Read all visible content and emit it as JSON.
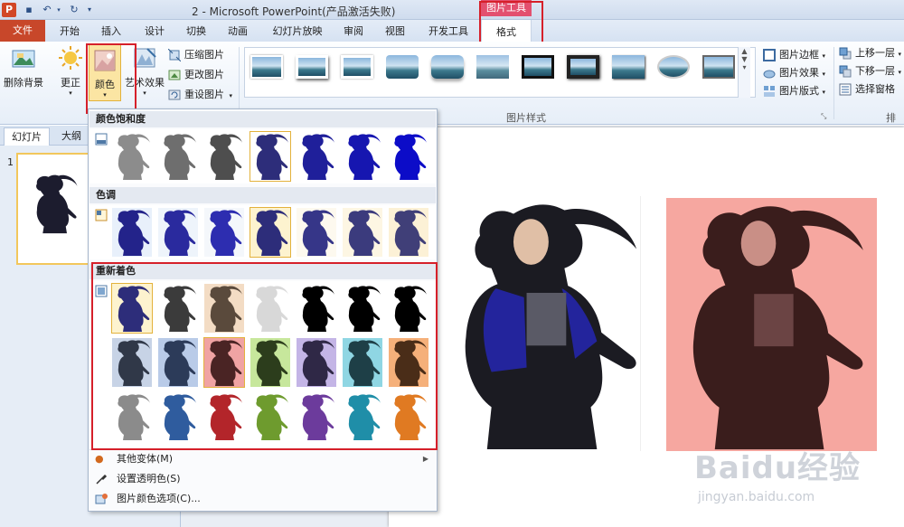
{
  "window": {
    "title": "2  -  Microsoft PowerPoint(产品激活失败)",
    "contextual_tools": "图片工具"
  },
  "tabs": [
    "文件",
    "开始",
    "插入",
    "设计",
    "切换",
    "动画",
    "幻灯片放映",
    "审阅",
    "视图",
    "开发工具",
    "格式"
  ],
  "ribbon": {
    "remove_background": "删除背景",
    "corrections": "更正",
    "color": "颜色",
    "artistic_effects": "艺术效果",
    "compress": "压缩图片",
    "change": "更改图片",
    "reset": "重设图片",
    "picture_border": "图片边框",
    "picture_effects": "图片效果",
    "picture_layout": "图片版式",
    "bring_forward": "上移一层",
    "send_backward": "下移一层",
    "selection_pane": "选择窗格",
    "group_styles": "图片样式",
    "group_arrange": "排列"
  },
  "left_pane": {
    "tab_slides": "幻灯片",
    "tab_outline": "大纲",
    "slide_number": "1"
  },
  "color_menu": {
    "saturation": "颜色饱和度",
    "tone": "色调",
    "recolor": "重新着色",
    "saturation_tints": [
      "#8c8c8c",
      "#6e6e6e",
      "#4e4e4e",
      "#2d2d7a",
      "#1f1f9a",
      "#1616b0",
      "#0c0cc8"
    ],
    "tone_tints": [
      "#23238a",
      "#2a2a9e",
      "#2d2db0",
      "#2d2d7a",
      "#363688",
      "#3b3b7d",
      "#403f78"
    ],
    "tone_backgrounds": [
      "#e8f0fb",
      "#eef4fb",
      "#f4f7fb",
      "#fdf3cf",
      "#fdf9ef",
      "#fdf6e3",
      "#fcf1d6"
    ],
    "recolor_row1_backgrounds": [
      "#fdf3cf",
      "#ffffff",
      "#f3dcc4",
      "#ffffff",
      "#ffffff",
      "#ffffff",
      "#ffffff"
    ],
    "recolor_row1_fills": [
      "#2d2d7a",
      "#3b3b3b",
      "#5a4a3c",
      "#d8d8d8",
      "#000000",
      "#000000",
      "#000000"
    ],
    "recolor_row2_backgrounds": [
      "#c7d3e6",
      "#b9cbe8",
      "#f0a3a3",
      "#c7e79c",
      "#c4b5e6",
      "#8fd6e3",
      "#f5b07a"
    ],
    "recolor_row2_fills": [
      "#303848",
      "#2c3b59",
      "#4a2424",
      "#2c3d1c",
      "#2f2846",
      "#1e3f47",
      "#4a2d18"
    ],
    "recolor_row3_fills": [
      "#8b8b8b",
      "#2f5c9e",
      "#b3252a",
      "#6e9b2e",
      "#6c3b9c",
      "#1f8ea8",
      "#e07a22"
    ],
    "more_variations": "其他变体(M)",
    "set_transparent": "设置透明色(S)",
    "color_options": "图片颜色选项(C)..."
  },
  "watermark": {
    "logo": "Baidu经验",
    "url": "jingyan.baidu.com"
  },
  "colors": {
    "file_tab": "#c8472a",
    "tools_header": "#e3506f",
    "highlight_box": "#d6202a",
    "selected_border": "#e3b23c",
    "recolor_slide_bg": "#f6a7a0"
  }
}
